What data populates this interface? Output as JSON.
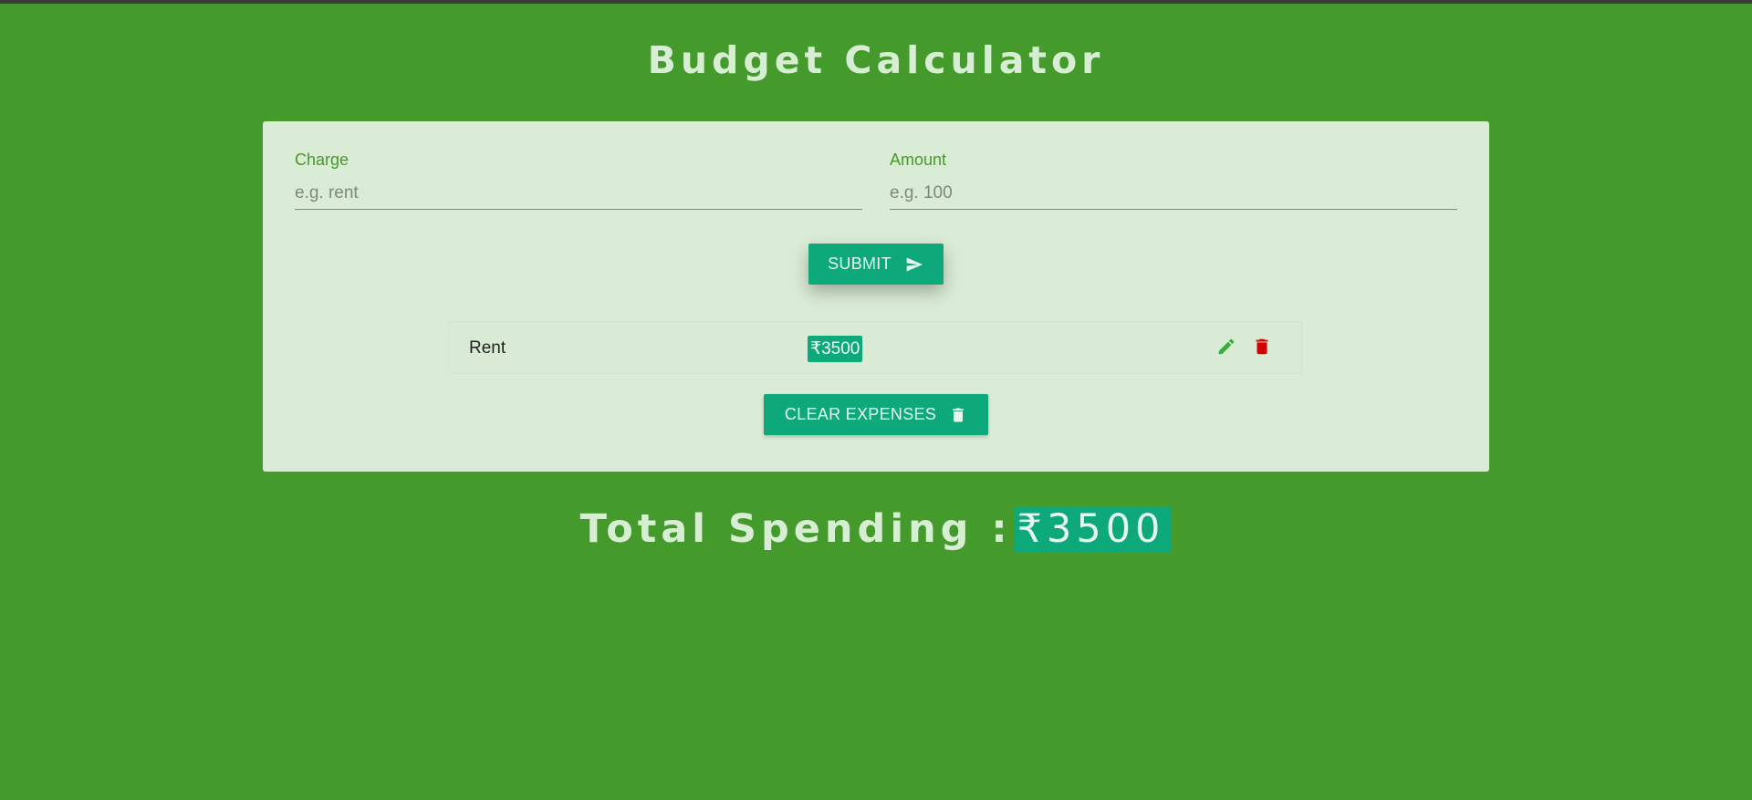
{
  "app": {
    "title": "Budget Calculator"
  },
  "form": {
    "charge_label": "Charge",
    "charge_placeholder": "e.g. rent",
    "charge_value": "",
    "amount_label": "Amount",
    "amount_placeholder": "e.g. 100",
    "amount_value": "",
    "submit_label": "SUBMIT",
    "submit_icon": "send-icon"
  },
  "expenses": [
    {
      "charge": "Rent",
      "amount": "₹3500",
      "edit_icon": "pencil-icon",
      "delete_icon": "trash-icon"
    }
  ],
  "clear_button": {
    "label": "CLEAR EXPENSES",
    "icon": "trash-icon"
  },
  "total": {
    "label": "Total Spending :",
    "amount": "₹3500"
  },
  "colors": {
    "background": "#459a2c",
    "card": "#daecd6",
    "accent": "#0ea97a",
    "edit": "#3cac3c",
    "delete": "#d40000",
    "title_text": "#d8eed4"
  }
}
